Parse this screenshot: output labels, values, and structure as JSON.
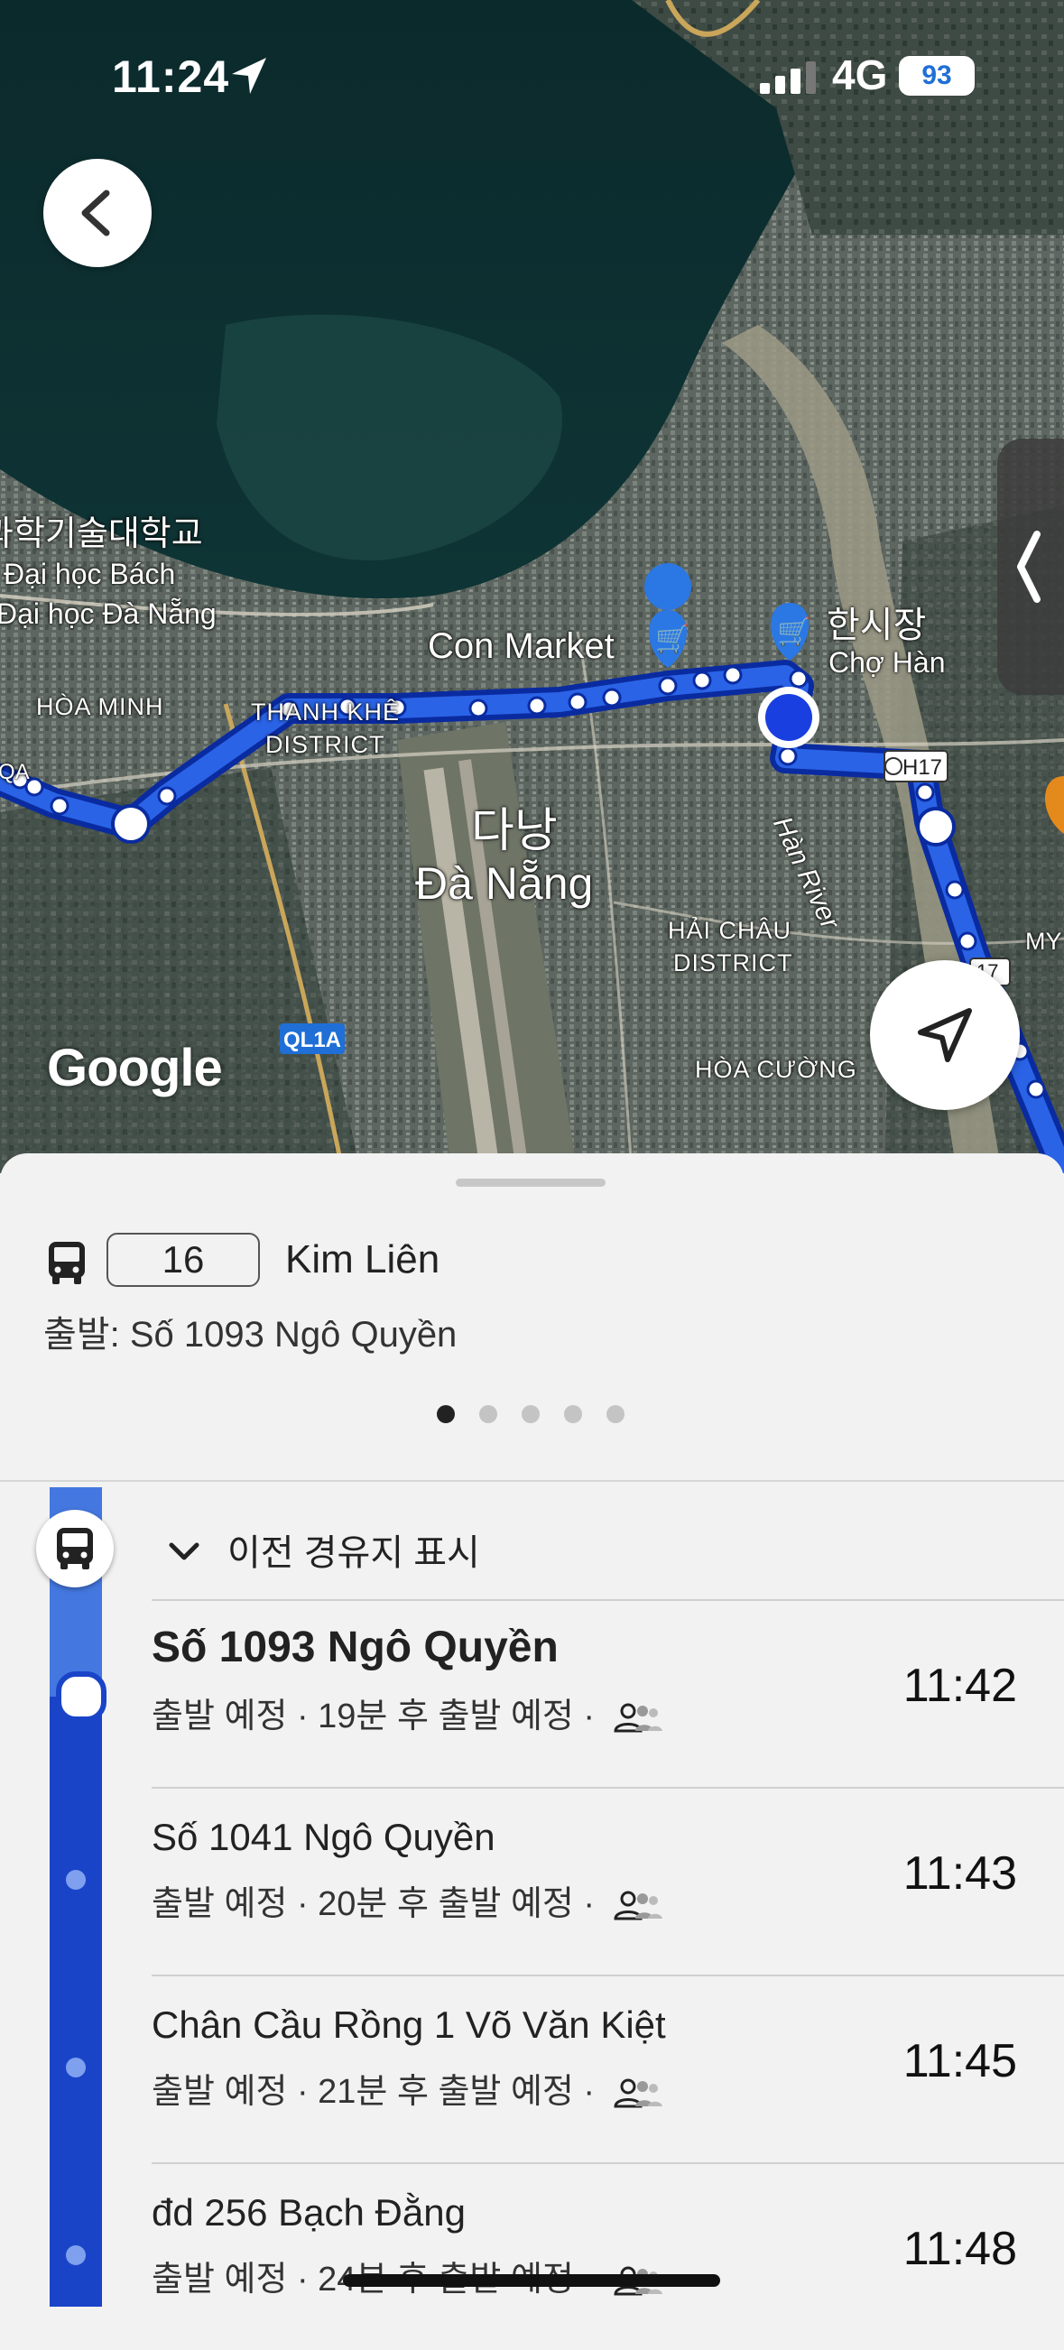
{
  "status_bar": {
    "time": "11:24",
    "network": "4G",
    "battery": "93"
  },
  "map": {
    "labels": {
      "university_ko": "과학기술대학교",
      "university_vi_1": "Đại học Bách",
      "university_vi_2": "Đại học Đà Nẵng",
      "hoa_minh": "HÒA MINH",
      "thanh_khe_1": "THANH KHÊ",
      "thanh_khe_2": "DISTRICT",
      "con_market": "Con Market",
      "han_market_ko": "한시장",
      "han_market_vi": "Chợ Hàn",
      "city_ko": "다낭",
      "city_vi": "Đà Nẵng",
      "hai_chau_1": "HẢI CHÂU",
      "hai_chau_2": "DISTRICT",
      "han_river": "Hàn River",
      "hoa_cuong": "HÒA CƯỜNG",
      "road_ql1a": "QL1A",
      "road_h17": "H17",
      "road_17": "17",
      "my": "MY",
      "partial_qa": "QA"
    },
    "google_logo": "Google"
  },
  "route": {
    "number": "16",
    "destination": "Kim Liên",
    "departure": "출발: Số 1093 Ngô Quyền",
    "page_count": 5,
    "active_page": 0
  },
  "timeline": {
    "show_previous_label": "이전 경유지 표시",
    "stops": [
      {
        "name": "Số 1093 Ngô Quyền",
        "status": "출발 예정 · 19분 후 출발 예정 ·",
        "time": "11:42",
        "current": true
      },
      {
        "name": "Số 1041 Ngô Quyền",
        "status": "출발 예정 · 20분 후 출발 예정 ·",
        "time": "11:43",
        "current": false
      },
      {
        "name": "Chân Cầu Rồng 1 Võ Văn Kiệt",
        "status": "출발 예정 · 21분 후 출발 예정 ·",
        "time": "11:45",
        "current": false
      },
      {
        "name": "đd 256 Bạch Đằng",
        "status": "출발 예정 · 24분 후 출발 예정 ·",
        "time": "11:48",
        "current": false
      }
    ]
  },
  "colors": {
    "route_blue": "#1a44c8",
    "accent_blue": "#1f6fd6"
  },
  "icons": [
    "location-arrow-icon",
    "back-chevron-icon",
    "bus-icon",
    "chevron-down-icon",
    "people-icon",
    "navigate-arrow-icon",
    "shopping-cart-icon"
  ]
}
